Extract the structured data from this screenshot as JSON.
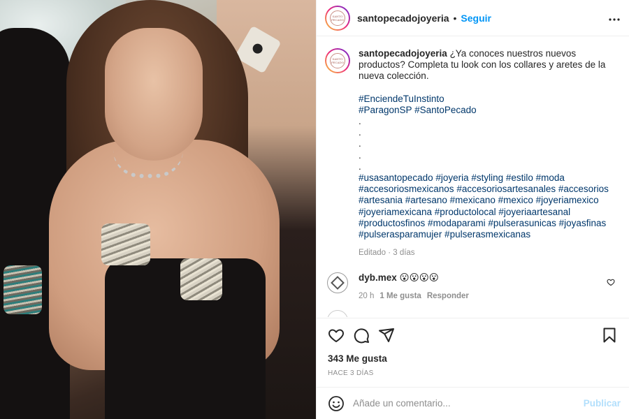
{
  "header": {
    "username": "santopecadojoyeria",
    "separator": "•",
    "follow_label": "Seguir",
    "more_icon": "more-options-icon",
    "avatar_logo_text": "SANTO PECADO"
  },
  "caption": {
    "username": "santopecadojoyeria",
    "line1": "¿Ya conoces nuestros nuevos productos? Completa tu look con los collares y aretes de la nueva colección.",
    "hashtags_block1": "#EnciendeTuInstinto\n#ParagonSP #SantoPecado",
    "dots": ".\n.\n.\n.\n.",
    "hashtags_block2": "#usasantopecado #joyeria #styling #estilo #moda #accesoriosmexicanos #accesoriosartesanales #accesorios #artesania #artesano #mexicano #mexico #joyeriamexico #joyeriamexicana #productolocal #joyeriaartesanal #productosfinos #modaparami #pulserasunicas #joyasfinas #pulserasparamujer #pulserasmexicanas",
    "meta": "Editado · 3 días"
  },
  "comments": [
    {
      "username": "dyb.mex",
      "text": "😮😮😮😮",
      "time": "20 h",
      "likes": "1 Me gusta",
      "reply": "Responder"
    }
  ],
  "actions": {
    "like_icon": "heart-icon",
    "comment_icon": "comment-icon",
    "share_icon": "share-icon",
    "save_icon": "bookmark-icon"
  },
  "likes_text": "343 Me gusta",
  "time_ago": "HACE 3 DÍAS",
  "add_comment": {
    "placeholder": "Añade un comentario...",
    "publish_label": "Publicar",
    "emoji_icon": "emoji-icon"
  },
  "colors": {
    "link_blue": "#0095f6",
    "hashtag": "#00376b",
    "muted": "#8e8e8e",
    "publish_disabled": "#b2dffc"
  }
}
